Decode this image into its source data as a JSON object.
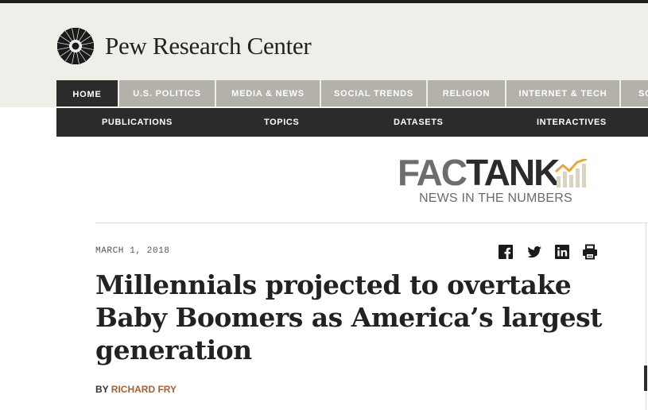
{
  "brand": {
    "name": "Pew Research Center"
  },
  "nav_primary": [
    {
      "label": "HOME",
      "active": true
    },
    {
      "label": "U.S. POLITICS",
      "active": false
    },
    {
      "label": "MEDIA & NEWS",
      "active": false
    },
    {
      "label": "SOCIAL TRENDS",
      "active": false
    },
    {
      "label": "RELIGION",
      "active": false
    },
    {
      "label": "INTERNET & TECH",
      "active": false
    },
    {
      "label": "SC",
      "active": false
    }
  ],
  "nav_secondary": [
    "PUBLICATIONS",
    "TOPICS",
    "DATASETS",
    "INTERACTIVES"
  ],
  "factank": {
    "word_a": "FAC",
    "word_b": "TANK",
    "tagline": "NEWS IN THE NUMBERS"
  },
  "article": {
    "date": "MARCH 1, 2018",
    "title": "Millennials projected to overtake Baby Boomers as America’s largest generation",
    "byline_prefix": "BY",
    "author": "RICHARD FRY"
  },
  "share_icons": [
    "facebook-icon",
    "twitter-icon",
    "linkedin-icon",
    "print-icon"
  ],
  "colors": {
    "header_bg": "#efeee9",
    "nav_tab": "#b3b1a9",
    "nav_dark": "#2b2b2b",
    "author": "#a3642f",
    "factank_accent": "#e8a838"
  }
}
